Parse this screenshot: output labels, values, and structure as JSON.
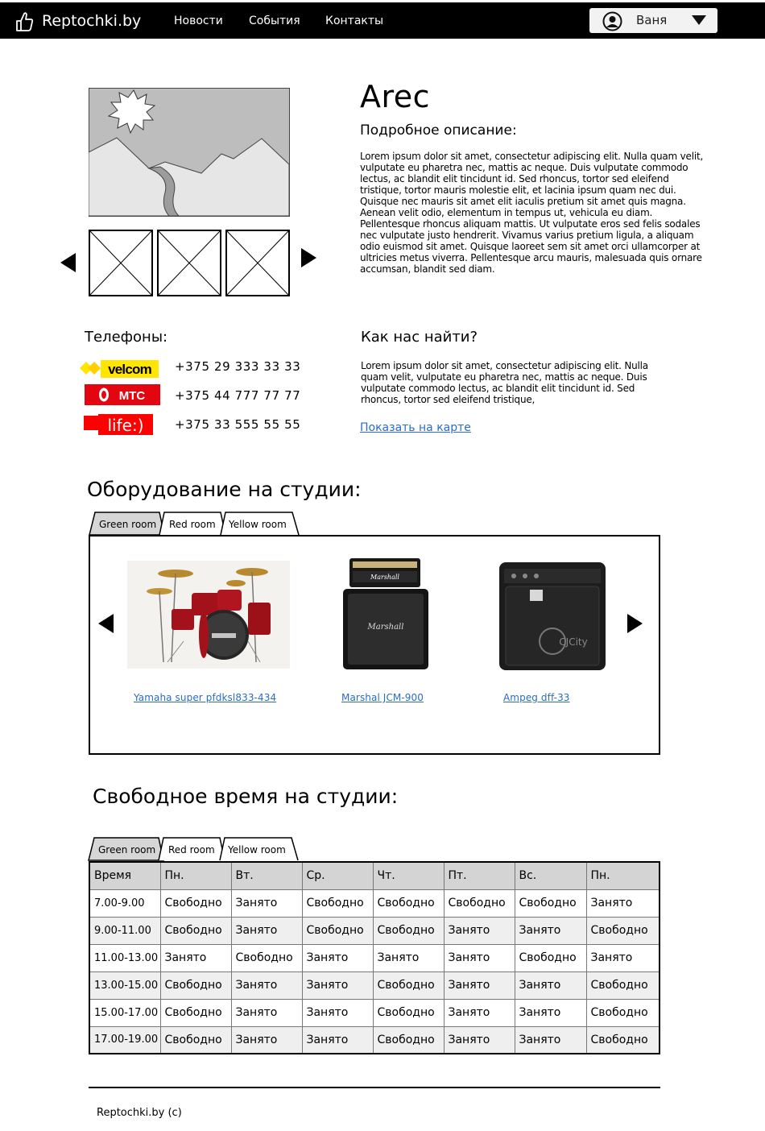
{
  "header": {
    "logo_text": "Reptochki.by",
    "logo_icon": "hand-thumb-icon",
    "nav": [
      "Новости",
      "События",
      "Контакты"
    ],
    "user": {
      "name": "Ваня",
      "avatar_icon": "user-icon",
      "caret_icon": "caret-down-icon"
    }
  },
  "studio": {
    "title": "Arec",
    "desc_heading": "Подробное описание:",
    "description": "Lorem ipsum dolor sit amet, consectetur adipiscing elit. Nulla quam velit, vulputate eu pharetra nec, mattis ac neque. Duis vulputate commodo lectus, ac blandit elit tincidunt id. Sed rhoncus, tortor sed eleifend tristique, tortor mauris molestie elit, et lacinia ipsum quam nec dui. Quisque nec mauris sit amet elit iaculis pretium sit amet quis magna. Aenean velit odio, elementum in tempus ut, vehicula eu diam. Pellentesque rhoncus aliquam mattis. Ut vulputate eros sed felis sodales nec vulputate justo hendrerit. Vivamus varius pretium ligula, a aliquam odio euismod sit amet. Quisque laoreet sem sit amet orci ullamcorper at ultricies metus viverra. Pellentesque arcu mauris, malesuada quis ornare accumsan, blandit sed diam."
  },
  "gallery": {
    "prev_icon": "arrow-left-icon",
    "next_icon": "arrow-right-icon"
  },
  "phones": {
    "heading": "Телефоны:",
    "items": [
      {
        "operator": "velcom",
        "number": "+375 29 333 33 33"
      },
      {
        "operator": "МТС",
        "number": "+375 44 777 77 77"
      },
      {
        "operator": "life:)",
        "number": "+375 33 555 55 55"
      }
    ]
  },
  "location": {
    "heading": "Как нас найти?",
    "text": "Lorem ipsum dolor sit amet, consectetur adipiscing elit. Nulla quam velit, vulputate eu pharetra nec, mattis ac neque. Duis vulputate commodo lectus, ac blandit elit tincidunt id. Sed rhoncus, tortor sed eleifend tristique,",
    "map_link": "Показать на карте"
  },
  "equipment": {
    "heading": "Оборудование на студии:",
    "tabs": [
      "Green room",
      "Red room",
      "Yellow room"
    ],
    "items": [
      {
        "name": "Yamaha super pfdksl833-434"
      },
      {
        "name": "Marshal JCM-900"
      },
      {
        "name": "Ampeg dff-33"
      }
    ],
    "ampeg_brand": "CJCity"
  },
  "schedule": {
    "heading": "Свободное время на студии:",
    "tabs": [
      "Green room",
      "Red room",
      "Yellow room"
    ],
    "columns": [
      "Время",
      "Пн.",
      "Вт.",
      "Ср.",
      "Чт.",
      "Пт.",
      "Вс.",
      "Пн."
    ],
    "rows": [
      [
        "7.00-9.00",
        "Свободно",
        "Занято",
        "Свободно",
        "Свободно",
        "Свободно",
        "Свободно",
        "Занято"
      ],
      [
        "9.00-11.00",
        "Свободно",
        "Занято",
        "Свободно",
        "Свободно",
        "Занято",
        "Занято",
        "Свободно"
      ],
      [
        "11.00-13.00",
        "Занято",
        "Свободно",
        "Занято",
        "Занято",
        "Занято",
        "Свободно",
        "Занято"
      ],
      [
        "13.00-15.00",
        "Свободно",
        "Занято",
        "Занято",
        "Свободно",
        "Занято",
        "Занято",
        "Свободно"
      ],
      [
        "15.00-17.00",
        "Свободно",
        "Занято",
        "Занято",
        "Свободно",
        "Занято",
        "Занято",
        "Свободно"
      ],
      [
        "17.00-19.00",
        "Свободно",
        "Занято",
        "Занято",
        "Свободно",
        "Занято",
        "Занято",
        "Свободно"
      ]
    ]
  },
  "footer": {
    "text": "Reptochki.by (c)"
  },
  "colors": {
    "link": "#2a6cc7",
    "topbar": "#000000",
    "velcom_yellow": "#ffe500",
    "mts_red": "#e30611",
    "life_red": "#ff0000"
  }
}
